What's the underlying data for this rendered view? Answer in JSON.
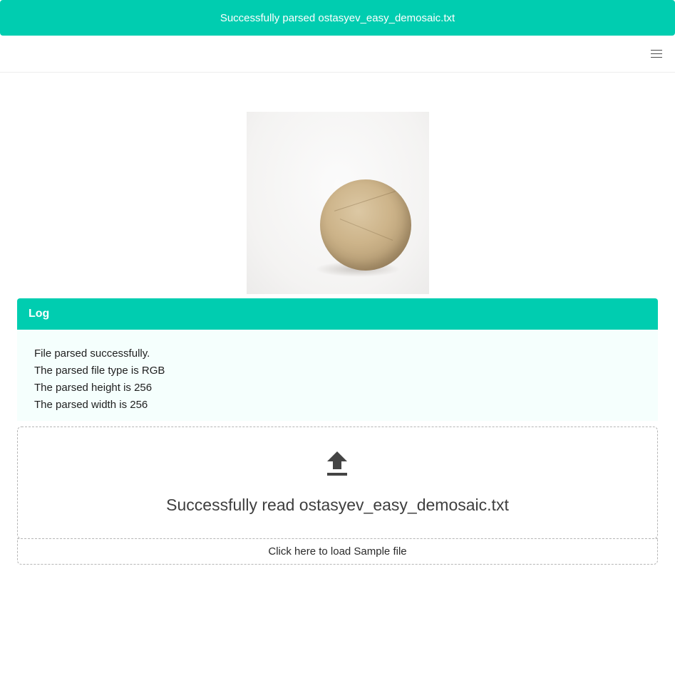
{
  "notification": {
    "message": "Successfully parsed ostasyev_easy_demosaic.txt",
    "color": "#00cdb0"
  },
  "navbar": {
    "menu_icon": "hamburger-menu-icon"
  },
  "preview": {
    "image_description_icon": "parsed-image-preview"
  },
  "log": {
    "title": "Log",
    "lines": [
      "File parsed successfully.",
      "The parsed file type is RGB",
      "The parsed height is 256",
      "The parsed width is 256"
    ]
  },
  "dropzone": {
    "icon": "upload-icon",
    "status_text": "Successfully read ostasyev_easy_demosaic.txt"
  },
  "sample": {
    "label": "Click here to load Sample file"
  },
  "colors": {
    "accent": "#00cdb0",
    "log_background": "#f5fffd",
    "border": "#b5b5b5"
  }
}
